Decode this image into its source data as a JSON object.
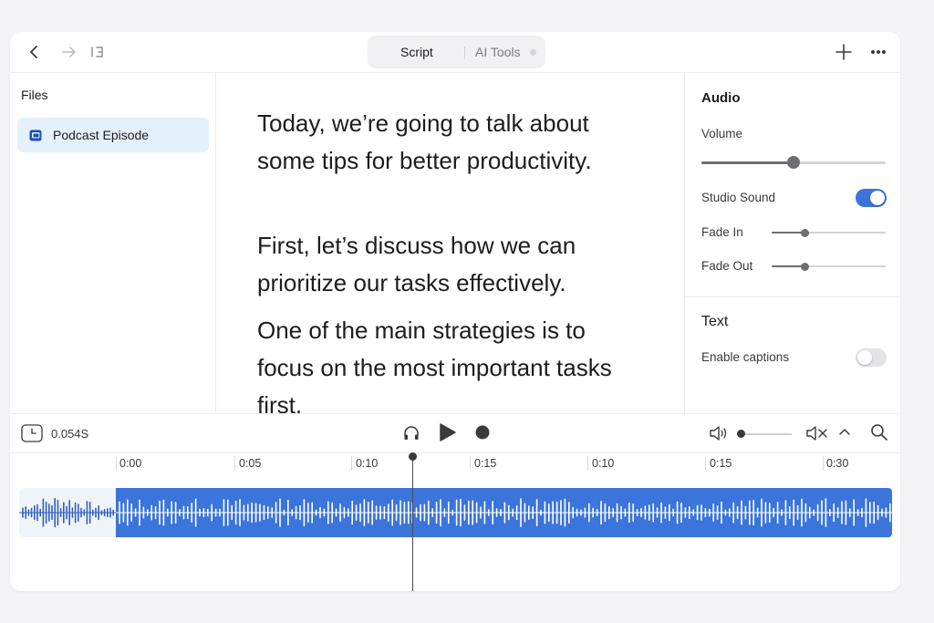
{
  "toolbar": {
    "tabs": [
      {
        "label": "Script",
        "active": true
      },
      {
        "label": "AI Tools",
        "active": false
      }
    ],
    "icons": [
      "back-icon",
      "forward-icon",
      "sidebar-toggle-icon",
      "plus-icon",
      "more-icon"
    ]
  },
  "sidebar": {
    "title": "Files",
    "items": [
      {
        "label": "Podcast Episode",
        "selected": true,
        "icon": "file-icon"
      }
    ]
  },
  "script": {
    "paragraphs": [
      "Today, we’re going to talk about some tips for better productivity.",
      "First, let’s discuss how we can prioritize our tasks effectively.",
      "One of the main strategies is to focus on the most important tasks first."
    ]
  },
  "panel": {
    "audio": {
      "title": "Audio",
      "volume_label": "Volume",
      "volume_level": 0.5,
      "studio_sound_label": "Studio Sound",
      "studio_sound_on": true,
      "fade_in_label": "Fade In",
      "fade_in_level": 0.29,
      "fade_out_label": "Fade Out",
      "fade_out_level": 0.29
    },
    "text": {
      "title": "Text",
      "captions_label": "Enable captions",
      "captions_on": false
    }
  },
  "transport": {
    "time": "0.054S",
    "volume_level": 0.0,
    "icons": [
      "clock-icon",
      "headphones-icon",
      "play-icon",
      "record-icon",
      "speaker-icon",
      "mute-icon",
      "chevron-up-icon",
      "search-icon"
    ]
  },
  "timeline": {
    "ticks": [
      "0:00",
      "0:05",
      "0:10",
      "0:15",
      "0:10",
      "0:15",
      "0:30"
    ]
  },
  "colors": {
    "accent": "#3b74da",
    "selected_bg": "#e5f0fd",
    "toggle_on": "#3b74da",
    "toggle_off": "#e3e3e6"
  }
}
